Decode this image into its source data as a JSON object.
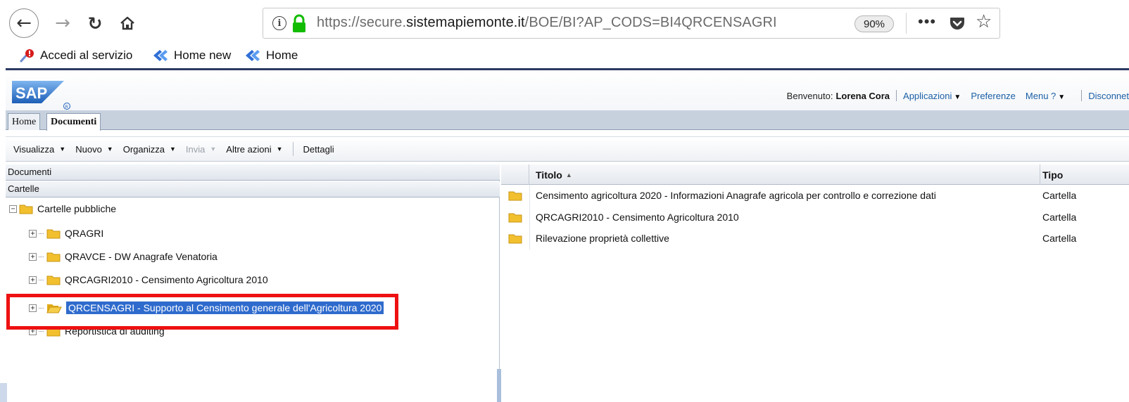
{
  "browser": {
    "url_prefix": "https://secure.",
    "url_domain": "sistemapiemonte.it",
    "url_path": "/BOE/BI?AP_CODS=BI4QRCENSAGRI",
    "zoom": "90%",
    "more_glyph": "•••",
    "bookmarks": [
      {
        "label": "Accedi al servizio"
      },
      {
        "label": "Home new"
      },
      {
        "label": "Home"
      }
    ]
  },
  "sap": {
    "welcome_label": "Benvenuto:",
    "user_name": "Lorena Cora",
    "links": {
      "applications": "Applicazioni",
      "preferences": "Preferenze",
      "help_menu": "Menu ?",
      "disconnect": "Disconnet"
    }
  },
  "tabs": [
    {
      "label": "Home",
      "active": false
    },
    {
      "label": "Documenti",
      "active": true
    }
  ],
  "toolbar": {
    "items": [
      {
        "label": "Visualizza",
        "enabled": true
      },
      {
        "label": "Nuovo",
        "enabled": true
      },
      {
        "label": "Organizza",
        "enabled": true
      },
      {
        "label": "Invia",
        "enabled": false
      },
      {
        "label": "Altre azioni",
        "enabled": true
      }
    ],
    "details_label": "Dettagli"
  },
  "left_pane": {
    "header": "Documenti",
    "folders_header": "Cartelle",
    "tree": {
      "root": {
        "label": "Cartelle pubbliche",
        "expanded": true
      },
      "children": [
        {
          "label": "QRAGRI",
          "selected": false
        },
        {
          "label": "QRAVCE - DW Anagrafe Venatoria",
          "selected": false
        },
        {
          "label": "QRCAGRI2010 - Censimento Agricoltura 2010",
          "selected": false
        },
        {
          "label": "QRCENSAGRI - Supporto al Censimento generale dell'Agricoltura 2020",
          "selected": true
        },
        {
          "label": "Reportistica di auditing",
          "selected": false
        }
      ]
    }
  },
  "right_pane": {
    "columns": {
      "title": "Titolo",
      "type": "Tipo"
    },
    "rows": [
      {
        "title": "Censimento agricoltura 2020 - Informazioni Anagrafe agricola per controllo e correzione dati",
        "type": "Cartella"
      },
      {
        "title": "QRCAGRI2010 - Censimento Agricoltura 2010",
        "type": "Cartella"
      },
      {
        "title": "Rilevazione proprietà collettive",
        "type": "Cartella"
      }
    ]
  },
  "colors": {
    "selection": "#2f6bcd",
    "annotation_box": "#ee1111",
    "sap_link": "#1b5fa5",
    "folder": "#f2c02f"
  }
}
